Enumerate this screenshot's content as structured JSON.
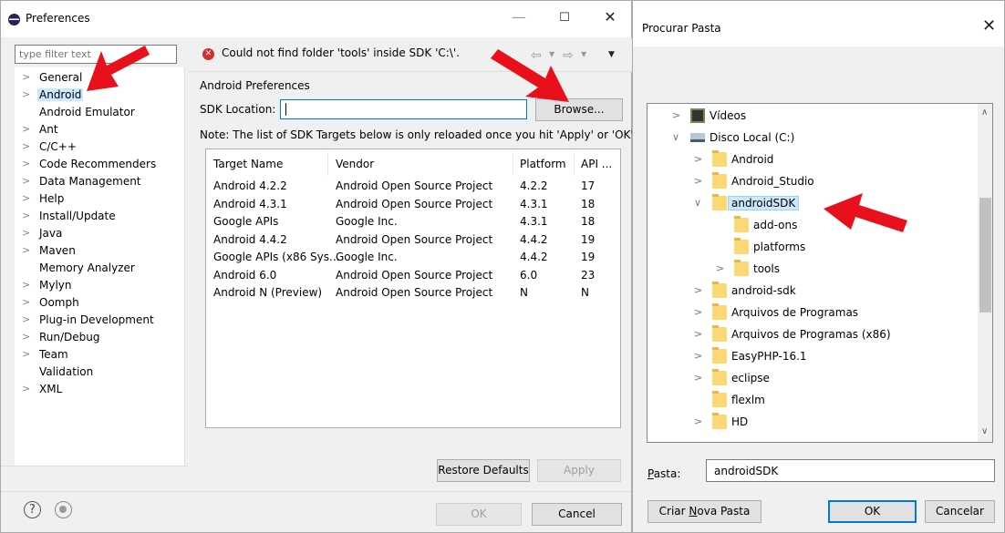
{
  "prefs": {
    "title": "Preferences",
    "min_glyph": "—",
    "max_glyph": "☐",
    "close_glyph": "✕",
    "filter_placeholder": "type filter text",
    "tree": [
      {
        "label": "General",
        "chevron": ">"
      },
      {
        "label": "Android",
        "chevron": ">",
        "selected": true
      },
      {
        "label": "Android Emulator",
        "chevron": ""
      },
      {
        "label": "Ant",
        "chevron": ">"
      },
      {
        "label": "C/C++",
        "chevron": ">"
      },
      {
        "label": "Code Recommenders",
        "chevron": ">"
      },
      {
        "label": "Data Management",
        "chevron": ">"
      },
      {
        "label": "Help",
        "chevron": ">"
      },
      {
        "label": "Install/Update",
        "chevron": ">"
      },
      {
        "label": "Java",
        "chevron": ">"
      },
      {
        "label": "Maven",
        "chevron": ">"
      },
      {
        "label": "Memory Analyzer",
        "chevron": ""
      },
      {
        "label": "Mylyn",
        "chevron": ">"
      },
      {
        "label": "Oomph",
        "chevron": ">"
      },
      {
        "label": "Plug-in Development",
        "chevron": ">"
      },
      {
        "label": "Run/Debug",
        "chevron": ">"
      },
      {
        "label": "Team",
        "chevron": ">"
      },
      {
        "label": "Validation",
        "chevron": ""
      },
      {
        "label": "XML",
        "chevron": ">"
      }
    ],
    "help_glyph": "?",
    "error_glyph": "✕",
    "error_message": "Could not find folder 'tools' inside SDK 'C:\\'.",
    "nav_back_glyph": "⇦",
    "nav_fwd_glyph": "⇨",
    "dropdown_glyph": "▼",
    "page_heading": "Android Preferences",
    "sdk_label": "SDK Location:",
    "sdk_value": "",
    "browse_label": "Browse...",
    "note": "Note: The list of SDK Targets below is only reloaded once you hit 'Apply' or 'OK'.",
    "table": {
      "headers": [
        "Target Name",
        "Vendor",
        "Platform",
        "API ..."
      ],
      "rows": [
        [
          "Android 4.2.2",
          "Android Open Source Project",
          "4.2.2",
          "17"
        ],
        [
          "Android 4.3.1",
          "Android Open Source Project",
          "4.3.1",
          "18"
        ],
        [
          "Google APIs",
          "Google Inc.",
          "4.3.1",
          "18"
        ],
        [
          "Android 4.4.2",
          "Android Open Source Project",
          "4.4.2",
          "19"
        ],
        [
          "Google APIs (x86 Sys...",
          "Google Inc.",
          "4.4.2",
          "19"
        ],
        [
          "Android 6.0",
          "Android Open Source Project",
          "6.0",
          "23"
        ],
        [
          "Android N (Preview)",
          "Android Open Source Project",
          "N",
          "N"
        ]
      ]
    },
    "restore_label": "Restore Defaults",
    "apply_label": "Apply",
    "ok_label": "OK",
    "cancel_label": "Cancel"
  },
  "browse_dialog": {
    "title": "Procurar Pasta",
    "close_glyph": "✕",
    "folders": [
      {
        "label": "Vídeos",
        "chevron": ">",
        "icon": "video",
        "level": 0
      },
      {
        "label": "Disco Local (C:)",
        "chevron": "∨",
        "icon": "drive",
        "level": 0
      },
      {
        "label": "Android",
        "chevron": ">",
        "icon": "folder",
        "level": 1
      },
      {
        "label": "Android_Studio",
        "chevron": ">",
        "icon": "folder",
        "level": 1
      },
      {
        "label": "androidSDK",
        "chevron": "∨",
        "icon": "folder",
        "level": 1,
        "selected": true
      },
      {
        "label": "add-ons",
        "chevron": "",
        "icon": "folder",
        "level": 2
      },
      {
        "label": "platforms",
        "chevron": "",
        "icon": "folder",
        "level": 2
      },
      {
        "label": "tools",
        "chevron": ">",
        "icon": "folder",
        "level": 2
      },
      {
        "label": "android-sdk",
        "chevron": ">",
        "icon": "folder",
        "level": 1
      },
      {
        "label": "Arquivos de Programas",
        "chevron": ">",
        "icon": "folder",
        "level": 1
      },
      {
        "label": "Arquivos de Programas (x86)",
        "chevron": ">",
        "icon": "folder",
        "level": 1
      },
      {
        "label": "EasyPHP-16.1",
        "chevron": ">",
        "icon": "folder",
        "level": 1
      },
      {
        "label": "eclipse",
        "chevron": ">",
        "icon": "folder",
        "level": 1
      },
      {
        "label": "flexlm",
        "chevron": "",
        "icon": "folder",
        "level": 1
      },
      {
        "label": "HD",
        "chevron": ">",
        "icon": "folder",
        "level": 1
      }
    ],
    "scroll_up_glyph": "∧",
    "scroll_down_glyph": "∨",
    "pasta_label_first": "P",
    "pasta_label_rest": "asta:",
    "pasta_value": "androidSDK",
    "new_folder_pre": "Criar ",
    "new_folder_u": "N",
    "new_folder_post": "ova Pasta",
    "ok_label": "OK",
    "cancel_label": "Cancelar"
  },
  "colors": {
    "selection": "#cce8ff",
    "arrow": "#e8101a",
    "focus_blue": "#0078d7",
    "error_red": "#d12f2f"
  }
}
